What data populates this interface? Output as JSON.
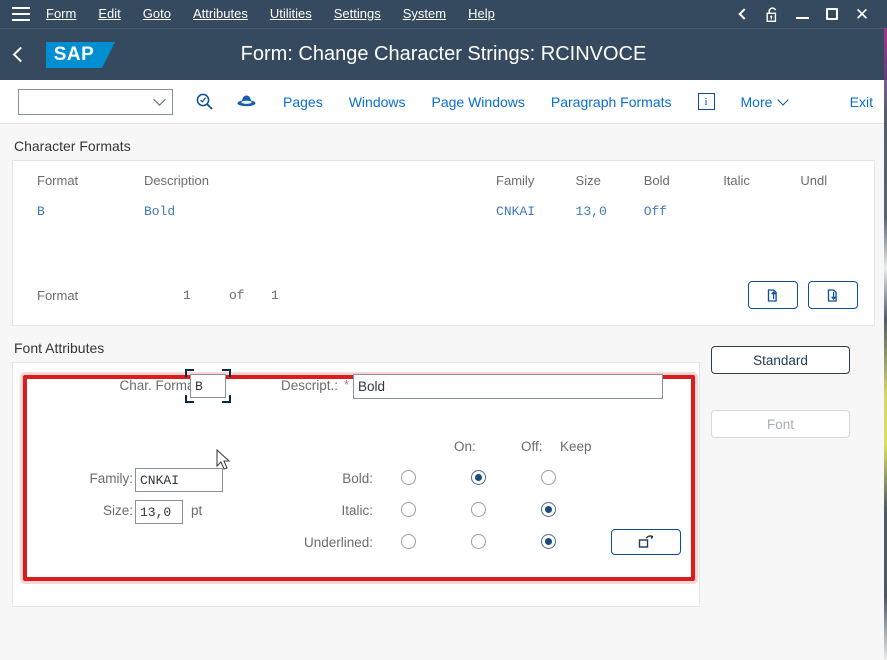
{
  "menubar": {
    "hamburger_icon": "hamburger-menu-icon",
    "items": [
      {
        "label": "Form",
        "mnemonic": "F"
      },
      {
        "label": "Edit",
        "mnemonic": "d"
      },
      {
        "label": "Goto",
        "mnemonic": "G"
      },
      {
        "label": "Attributes",
        "mnemonic": "A"
      },
      {
        "label": "Utilities",
        "mnemonic": "s"
      },
      {
        "label": "Settings",
        "mnemonic": "t"
      },
      {
        "label": "System",
        "mnemonic": "y"
      },
      {
        "label": "Help",
        "mnemonic": "H"
      }
    ],
    "window_controls": [
      "back-chevron-icon",
      "unlocked-padlock-icon",
      "minimize-icon",
      "maximize-icon",
      "close-icon"
    ]
  },
  "titlebar": {
    "back_icon": "back-chevron-icon",
    "logo_text": "SAP",
    "title": "Form: Change Character Strings: RCINVOCE"
  },
  "toolbar": {
    "select_value": "",
    "select_icon": "chevron-down-icon",
    "search_icon": "search-magnifier-icon",
    "hat_icon": "blue-hat-icon",
    "links": [
      "Pages",
      "Windows",
      "Page Windows",
      "Paragraph Formats"
    ],
    "info_icon": "information-icon",
    "info_letter": "i",
    "more_label": "More",
    "more_icon": "chevron-down-icon",
    "exit_label": "Exit"
  },
  "character_formats": {
    "section_title": "Character Formats",
    "columns": [
      "Format",
      "Description",
      "Family",
      "Size",
      "Bold",
      "Italic",
      "Undl"
    ],
    "rows": [
      {
        "format": "B",
        "description": "Bold",
        "family": "CNKAI",
        "size": "13,0",
        "bold": "Off",
        "italic": "",
        "undl": ""
      }
    ],
    "footer": {
      "label": "Format",
      "current": "1",
      "of": "of",
      "total": "1",
      "button_prev_icon": "page-up-arrow-icon",
      "button_next_icon": "page-down-arrow-icon"
    }
  },
  "font_attributes": {
    "section_title": "Font Attributes",
    "char_format_label": "Char. Format:",
    "char_format_value": "B",
    "descript_label": "Descript.:",
    "descript_required": "*",
    "descript_value": "Bold",
    "family_label": "Family:",
    "family_value": "CNKAI",
    "size_label": "Size:",
    "size_value": "13,0",
    "size_unit": "pt",
    "column_headers": {
      "on": "On:",
      "off": "Off:",
      "keep": "Keep"
    },
    "attributes": [
      {
        "label": "Bold:",
        "selected": 1
      },
      {
        "label": "Italic:",
        "selected": 2
      },
      {
        "label": "Underlined:",
        "selected": 2
      }
    ],
    "popup_button_icon": "open-in-new-window-icon",
    "standard_button": "Standard",
    "font_button": "Font"
  },
  "colors": {
    "header_bg": "#354a5f",
    "sap_blue": "#008fd3",
    "link_blue": "#0a6ed1",
    "highlight_red": "#d91c1c",
    "mono_value_blue": "#3f7bbf"
  }
}
